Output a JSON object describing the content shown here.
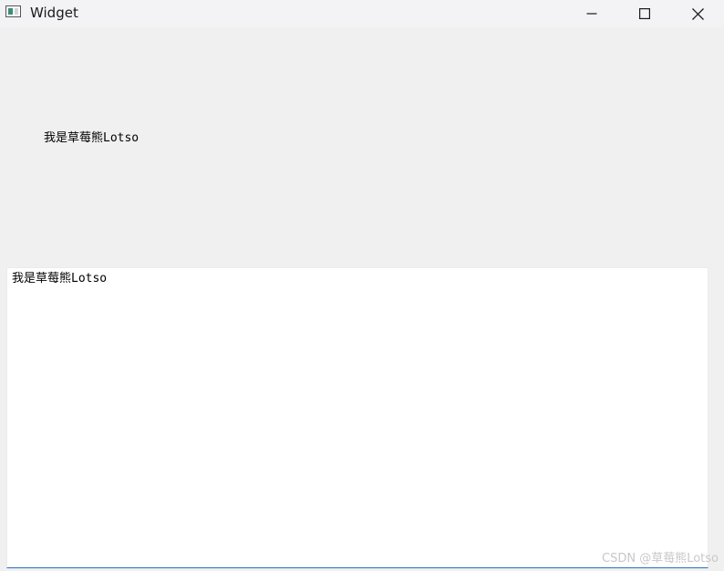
{
  "window": {
    "title": "Widget",
    "icon": "window-app-icon"
  },
  "titlebar": {
    "minimize_icon": "minimize-icon",
    "maximize_icon": "maximize-icon",
    "close_icon": "close-icon"
  },
  "label": {
    "text": "我是草莓熊Lotso"
  },
  "text_edit": {
    "value": "我是草莓熊Lotso"
  },
  "watermark": {
    "text": "CSDN @草莓熊Lotso"
  },
  "colors": {
    "focus_border": "#2b6cc4",
    "background": "#f0f0f0"
  }
}
